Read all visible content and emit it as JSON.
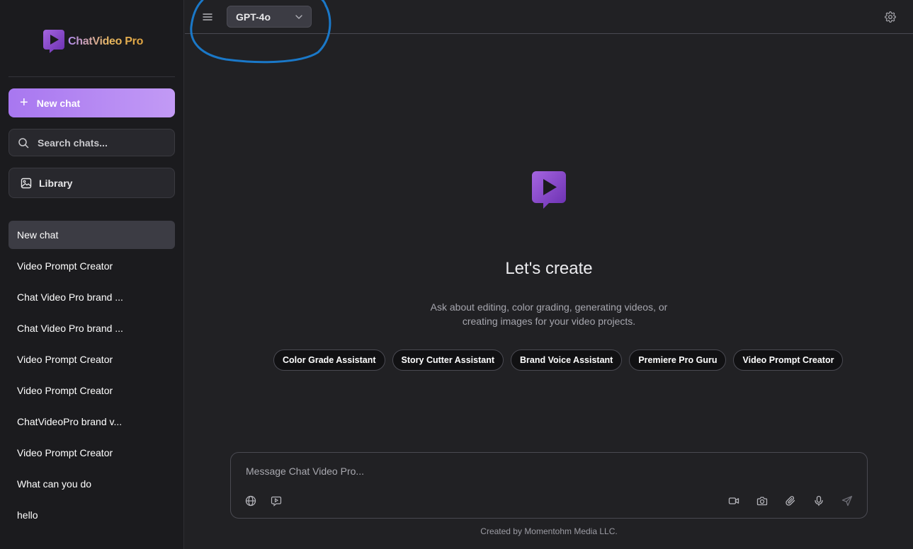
{
  "brand": {
    "name": "ChatVideo Pro"
  },
  "sidebar": {
    "new_chat_label": "New chat",
    "search_placeholder": "Search chats...",
    "library_label": "Library",
    "chats": [
      {
        "label": "New chat",
        "active": true
      },
      {
        "label": "Video Prompt Creator"
      },
      {
        "label": "Chat Video Pro brand ..."
      },
      {
        "label": "Chat Video Pro brand ..."
      },
      {
        "label": "Video Prompt Creator"
      },
      {
        "label": "Video Prompt Creator"
      },
      {
        "label": "ChatVideoPro brand v..."
      },
      {
        "label": "Video Prompt Creator"
      },
      {
        "label": "What can you do"
      },
      {
        "label": "hello"
      }
    ]
  },
  "header": {
    "model": "GPT-4o",
    "icons": [
      "menu-icon",
      "chevron-down-icon",
      "gear-icon"
    ]
  },
  "hero": {
    "title": "Let's create",
    "subtitle": "Ask about editing, color grading, generating videos, or creating images for your video projects.",
    "chips": [
      "Color Grade Assistant",
      "Story Cutter Assistant",
      "Brand Voice Assistant",
      "Premiere Pro Guru",
      "Video Prompt Creator"
    ]
  },
  "composer": {
    "placeholder": "Message Chat Video Pro...",
    "tools_left": [
      "globe-icon",
      "video-chat-icon"
    ],
    "tools_right": [
      "video-camera-icon",
      "camera-icon",
      "paperclip-icon",
      "microphone-icon",
      "send-icon"
    ]
  },
  "footer": {
    "text": "Created by Momentohm Media LLC."
  },
  "colors": {
    "accent": "#a877f0",
    "background": "#212124",
    "sidebar": "#1b1b1e",
    "annotation": "#1a78c8"
  }
}
